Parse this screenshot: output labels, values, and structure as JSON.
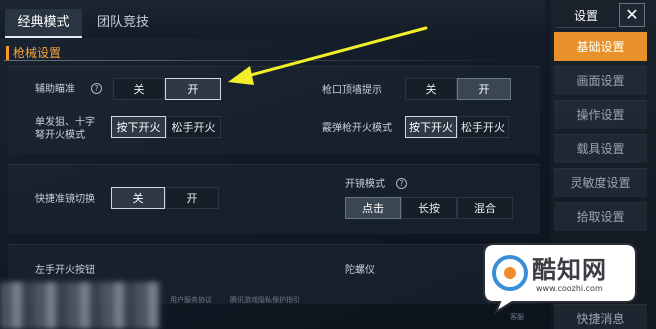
{
  "mode_tabs": {
    "classic": "经典模式",
    "team": "团队竞技"
  },
  "section": {
    "title": "枪械设置"
  },
  "settings": {
    "aim_assist": {
      "label": "辅助瞄准",
      "help": "?",
      "off": "关",
      "on": "开"
    },
    "muzzle_hint": {
      "label": "枪口顶墙提示",
      "off": "关",
      "on": "开"
    },
    "single_fire": {
      "label_line1": "单发狙、十字",
      "label_line2": "弩开火模式",
      "press": "按下开火",
      "release": "松手开火"
    },
    "shotgun_fire": {
      "label": "霰弹枪开火模式",
      "press": "按下开火",
      "release": "松手开火"
    },
    "scope_switch": {
      "label": "快捷准镜切换",
      "off": "关",
      "on": "开"
    },
    "scope_mode": {
      "label": "开镜模式",
      "help": "?",
      "tap": "点击",
      "hold": "长按",
      "mixed": "混合"
    },
    "left_fire": {
      "label": "左手开火按钮"
    },
    "gyroscope": {
      "label": "陀螺仪"
    }
  },
  "footer": {
    "text1": "用户服务协议",
    "text2": "腾讯游戏隐私保护指引",
    "text3": "客服"
  },
  "sidebar": {
    "title": "设置",
    "close": "✕",
    "items": [
      {
        "label": "基础设置",
        "active": true
      },
      {
        "label": "画面设置",
        "active": false
      },
      {
        "label": "操作设置",
        "active": false
      },
      {
        "label": "载具设置",
        "active": false
      },
      {
        "label": "灵敏度设置",
        "active": false
      },
      {
        "label": "拾取设置",
        "active": false
      },
      {
        "label": "快捷消息",
        "active": false
      }
    ]
  },
  "watermark": {
    "brand": "酷知网",
    "url": "www.coozhi.com"
  },
  "colors": {
    "accent": "#e8912a",
    "section": "#f5a53b",
    "arrow": "#f2ee2a"
  }
}
